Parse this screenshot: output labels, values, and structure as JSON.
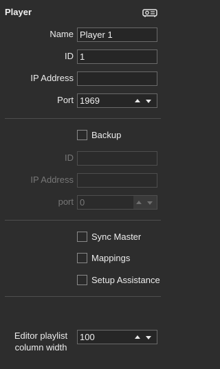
{
  "header": {
    "title": "Player",
    "icon": "projector-icon"
  },
  "fields": {
    "name": {
      "label": "Name",
      "value": "Player 1"
    },
    "id": {
      "label": "ID",
      "value": "1"
    },
    "ip": {
      "label": "IP Address",
      "value": ""
    },
    "port": {
      "label": "Port",
      "value": "1969"
    }
  },
  "backup": {
    "checkbox_label": "Backup",
    "checked": false,
    "id_label": "ID",
    "id_value": "",
    "ip_label": "IP Address",
    "ip_value": "",
    "port_label": "port",
    "port_value": "0"
  },
  "options": [
    {
      "label": "Sync Master",
      "checked": false
    },
    {
      "label": "Mappings",
      "checked": false
    },
    {
      "label": "Setup Assistance",
      "checked": false
    }
  ],
  "editor": {
    "label_line1": "Editor playlist",
    "label_line2": "column width",
    "value": "100"
  },
  "colors": {
    "background": "#2d2d2d",
    "border": "#6a6a6a",
    "disabled_text": "#777777"
  }
}
